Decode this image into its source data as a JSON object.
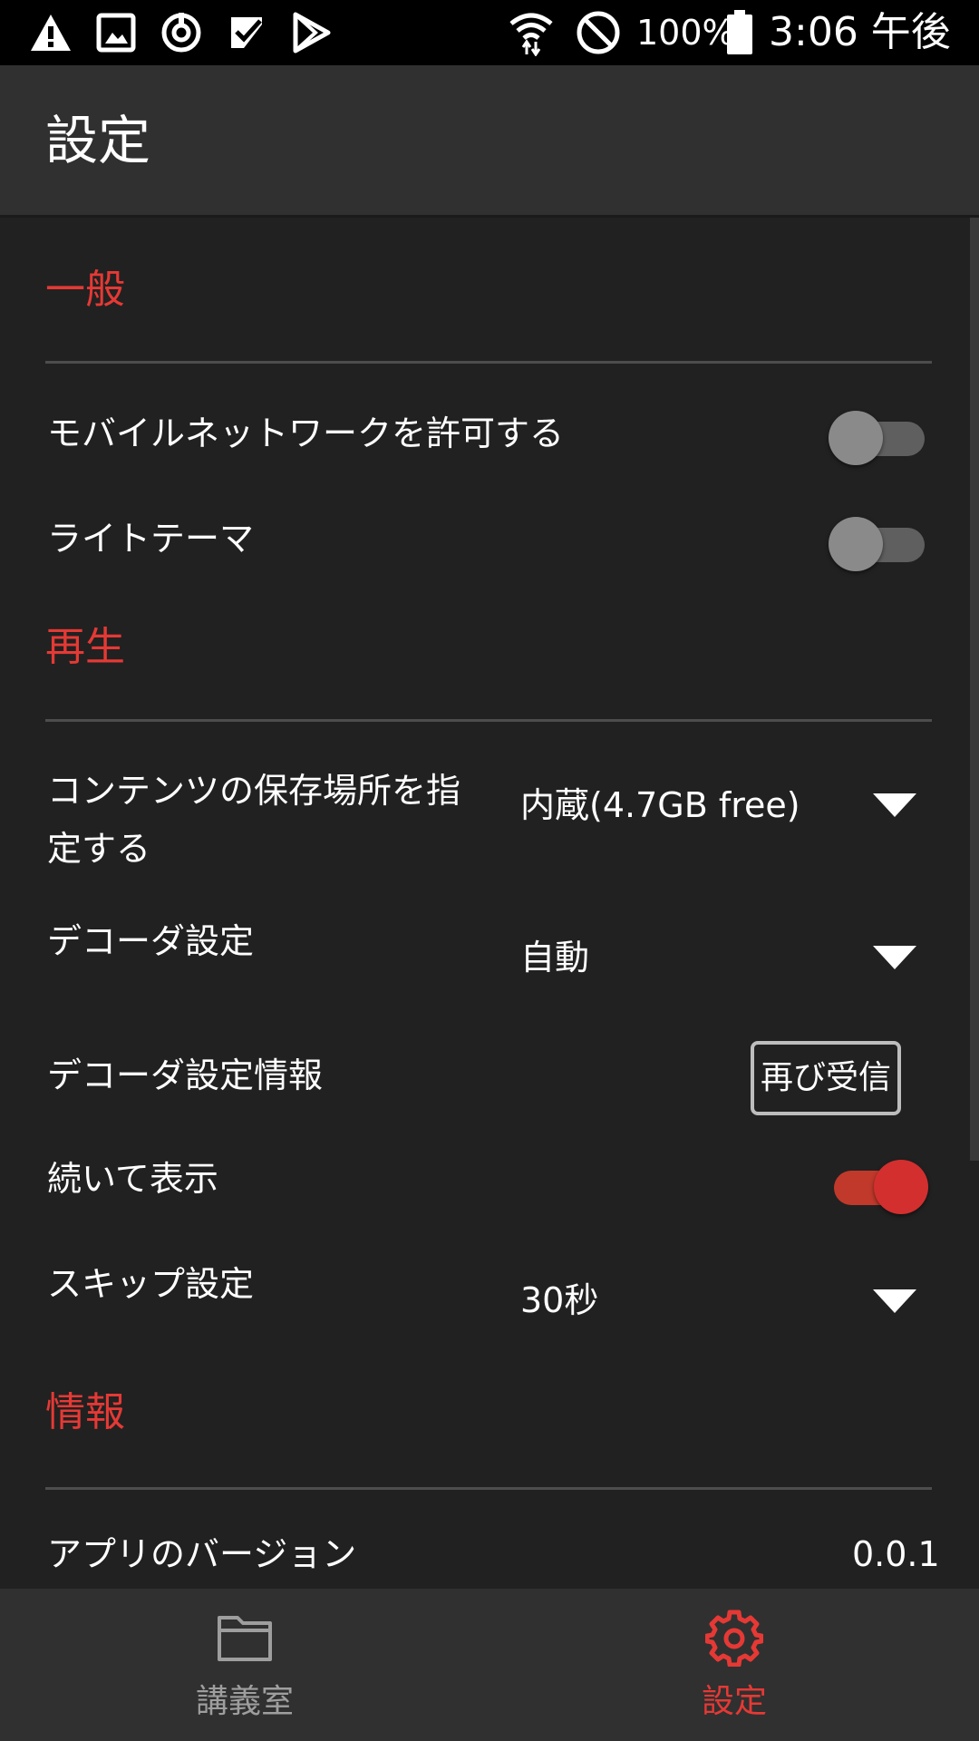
{
  "status_bar": {
    "icons_left": [
      "warning-icon",
      "image-icon",
      "sync-icon",
      "check-icon",
      "play-store-icon"
    ],
    "icons_right": [
      "wifi-icon",
      "do-not-disturb-icon",
      "battery-icon"
    ],
    "battery_percent": "100%",
    "time": "3:06 午後"
  },
  "app_bar": {
    "title": "設定"
  },
  "sections": {
    "general": {
      "header": "一般",
      "mobile_network": {
        "label": "モバイルネットワークを許可する",
        "enabled": false
      },
      "light_theme": {
        "label": "ライトテーマ",
        "enabled": false
      }
    },
    "playback": {
      "header": "再生",
      "storage": {
        "label_line1": "コンテンツの保存場所を指",
        "label_line2": "定する",
        "value": "内蔵(4.7GB free)"
      },
      "decoder": {
        "label": "デコーダ設定",
        "value": "自動"
      },
      "decoder_info": {
        "label": "デコーダ設定情報",
        "button": "再び受信"
      },
      "continuous": {
        "label": "続いて表示",
        "enabled": true
      },
      "skip": {
        "label": "スキップ設定",
        "value": "30秒"
      }
    },
    "info": {
      "header": "情報",
      "version": {
        "label": "アプリのバージョン",
        "value": "0.0.1"
      }
    }
  },
  "bottom_nav": {
    "items": [
      {
        "label": "講義室",
        "icon": "folder-icon",
        "active": false
      },
      {
        "label": "設定",
        "icon": "gear-icon",
        "active": true
      }
    ]
  },
  "colors": {
    "accent": "#e53935",
    "background": "#212121",
    "bar": "#303030",
    "inactive": "#9e9e9e"
  }
}
